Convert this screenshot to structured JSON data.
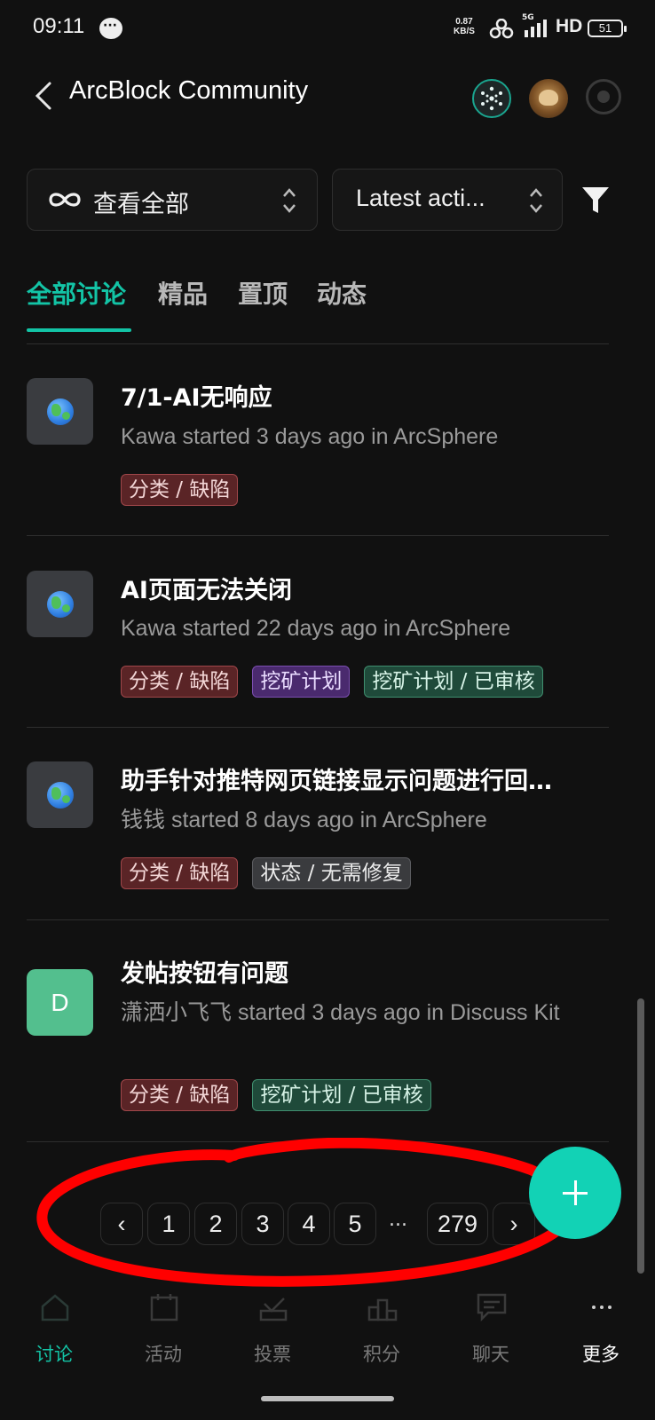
{
  "status_bar": {
    "time": "09:11",
    "net_speed_value": "0.87",
    "net_speed_unit": "KB/S",
    "network": "5G",
    "hd": "HD",
    "battery": "51"
  },
  "header": {
    "title": "ArcBlock Community",
    "icons": [
      "back-icon",
      "arcsphere-icon",
      "user-avatar",
      "record-icon"
    ]
  },
  "filters": {
    "view_label": "查看全部",
    "sort_label": "Latest acti...",
    "icons": [
      "infinity-icon",
      "sort-updown-icon",
      "funnel-icon"
    ]
  },
  "tabs": [
    {
      "label": "全部讨论",
      "active": true
    },
    {
      "label": "精品"
    },
    {
      "label": "置顶"
    },
    {
      "label": "动态"
    }
  ],
  "discussions": [
    {
      "title": "7/1-AI无响应",
      "meta": "Kawa started 3 days ago in ArcSphere",
      "avatar": "globe-emoji",
      "tags": [
        {
          "label": "分类 / 缺陷",
          "color": "red"
        }
      ]
    },
    {
      "title": "AI页面无法关闭",
      "meta": "Kawa started 22 days ago in ArcSphere",
      "avatar": "globe-emoji",
      "tags": [
        {
          "label": "分类 / 缺陷",
          "color": "red"
        },
        {
          "label": "挖矿计划",
          "color": "purple"
        },
        {
          "label": "挖矿计划 / 已审核",
          "color": "green"
        }
      ]
    },
    {
      "title": "助手针对推特网页链接显示问题进行回…",
      "meta": "钱钱 started 8 days ago in ArcSphere",
      "avatar": "globe-emoji",
      "tags": [
        {
          "label": "分类 / 缺陷",
          "color": "red"
        },
        {
          "label": "状态 / 无需修复",
          "color": "gray"
        }
      ]
    },
    {
      "title": "发帖按钮有问题",
      "meta": "潇洒小飞飞 started 3 days ago in Discuss Kit",
      "avatar_letter": "D",
      "tags": [
        {
          "label": "分类 / 缺陷",
          "color": "red"
        },
        {
          "label": "挖矿计划 / 已审核",
          "color": "green"
        }
      ]
    }
  ],
  "pagination": {
    "prev": "‹",
    "pages": [
      "1",
      "2",
      "3",
      "4",
      "5"
    ],
    "ellipsis": "...",
    "last": "279",
    "next": "›"
  },
  "fab_label": "+",
  "bottom_nav": [
    {
      "label": "讨论",
      "icon": "home-icon",
      "active": true
    },
    {
      "label": "活动",
      "icon": "calendar-icon"
    },
    {
      "label": "投票",
      "icon": "vote-icon"
    },
    {
      "label": "积分",
      "icon": "podium-icon"
    },
    {
      "label": "聊天",
      "icon": "chat-icon"
    },
    {
      "label": "更多",
      "icon": "more-icon"
    }
  ],
  "colors": {
    "accent": "#13c4a6",
    "background": "#111111",
    "annotation_red": "#ff0000"
  }
}
